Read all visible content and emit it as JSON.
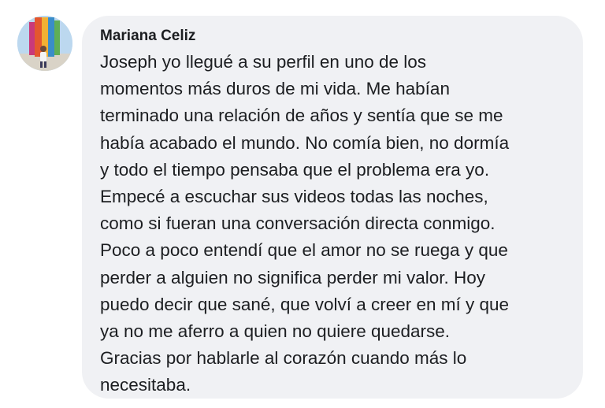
{
  "comment": {
    "author": "Mariana Celiz",
    "lines": [
      "Joseph yo llegué a su perfil en uno de los",
      "momentos más duros de mi vida. Me habían",
      "terminado una relación de años y sentía que se me",
      "había acabado el mundo. No comía bien, no dormía",
      "y todo el tiempo pensaba que el problema era yo.",
      "Empecé a escuchar sus videos todas las noches,",
      "como si fueran una conversación directa conmigo.",
      "Poco a poco entendí que el amor no se ruega y que",
      "perder a alguien no significa perder mi valor. Hoy",
      "puedo decir que sané, que volví a creer en mí y que",
      "ya no me aferro a quien no quiere quedarse.",
      "Gracias por hablarle al corazón cuando más lo",
      "necesitaba."
    ]
  },
  "colors": {
    "bubble_background": "#f0f1f4",
    "text": "#1c1e21",
    "page_background": "#ffffff"
  }
}
